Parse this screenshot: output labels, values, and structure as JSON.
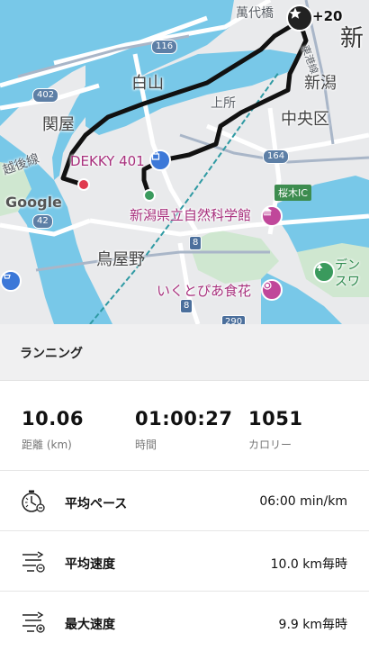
{
  "map": {
    "labels": {
      "bandai_bridge": "萬代橋",
      "shin": "新",
      "hakusan": "白山",
      "sekiya": "関屋",
      "kamitokoro": "上所",
      "chuo_ku": "中央区",
      "niigata": "新潟",
      "joetsu_line": "越後線",
      "hakushin_line": "東港線",
      "dekky": "DEKKY 401",
      "museum": "新潟県立自然科学館",
      "toriyano": "鳥屋野",
      "itokopia": "いくとぴあ食花",
      "denka": "デン\nスワ",
      "sakuragi_ic": "桜木IC",
      "google": "Google"
    },
    "route_shields": [
      "116",
      "402",
      "164",
      "42",
      "8",
      "8",
      "290"
    ],
    "star_count": "+20",
    "colors": {
      "water": "#78c8e8",
      "land": "#e9eaec",
      "park": "#cfe7d0",
      "route": "#111111",
      "start_dot": "#3a9a5d",
      "end_dot": "#e03a4e"
    }
  },
  "activity": {
    "title": "ランニング"
  },
  "stats": [
    {
      "value": "10.06",
      "label": "距離 (km)"
    },
    {
      "value": "01:00:27",
      "label": "時間"
    },
    {
      "value": "1051",
      "label": "カロリー"
    }
  ],
  "rows": [
    {
      "icon": "stopwatch-icon",
      "label": "平均ペース",
      "value": "06:00 min/km"
    },
    {
      "icon": "speed-average-icon",
      "label": "平均速度",
      "value": "10.0 km毎時"
    },
    {
      "icon": "speed-max-icon",
      "label": "最大速度",
      "value": "9.9 km毎時"
    }
  ]
}
